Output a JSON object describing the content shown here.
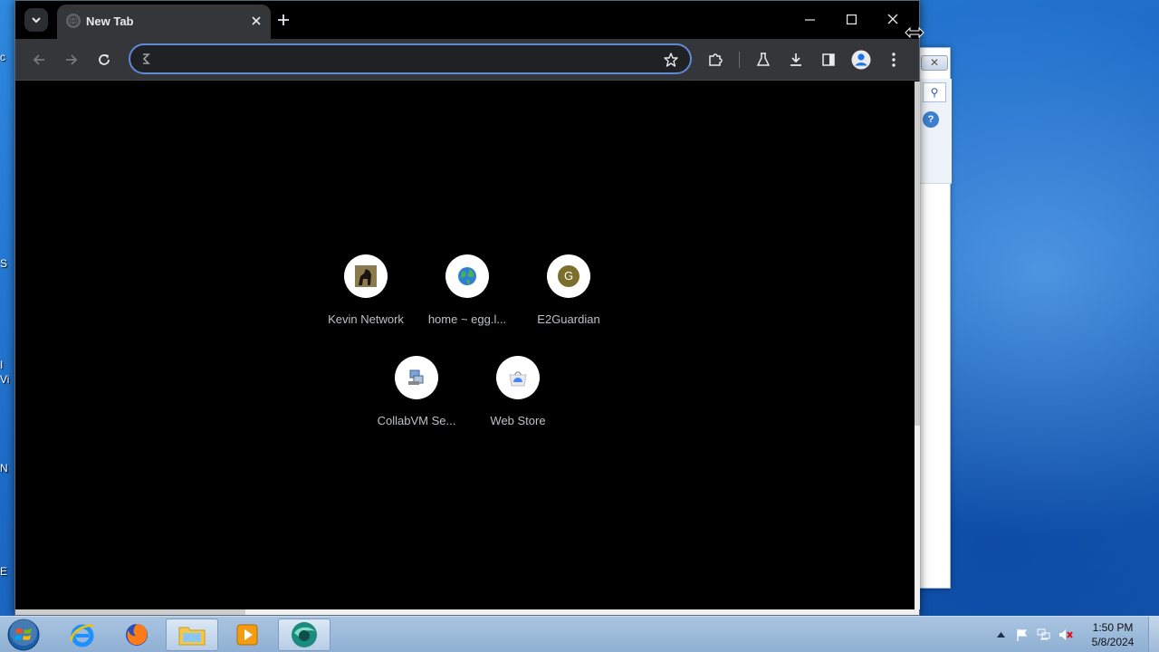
{
  "desktop": {
    "edge_letters": [
      "S",
      "I",
      "Vi",
      "N",
      "E"
    ]
  },
  "browser": {
    "tab": {
      "title": "New Tab"
    },
    "omnibox": {
      "value": "",
      "placeholder": ""
    },
    "shortcuts": [
      {
        "label": "Kevin Network",
        "icon": "horse-favicon"
      },
      {
        "label": "home ~ egg.l...",
        "icon": "globe-favicon"
      },
      {
        "label": "E2Guardian",
        "icon": "letter-g-favicon",
        "letter": "G"
      },
      {
        "label": "CollabVM Se...",
        "icon": "collabvm-favicon"
      },
      {
        "label": "Web Store",
        "icon": "webstore-favicon"
      }
    ]
  },
  "taskbar": {
    "apps": [
      "internet-explorer",
      "firefox",
      "file-explorer",
      "media-player",
      "chrome-like-browser"
    ],
    "clock": {
      "time": "1:50 PM",
      "date": "5/8/2024"
    }
  },
  "colors": {
    "chrome_frame": "#000000",
    "toolbar": "#35363a",
    "omnibox_focus": "#5e8ad8",
    "taskbar": "#a9c4e1",
    "desktop": "#1e6cc8"
  }
}
